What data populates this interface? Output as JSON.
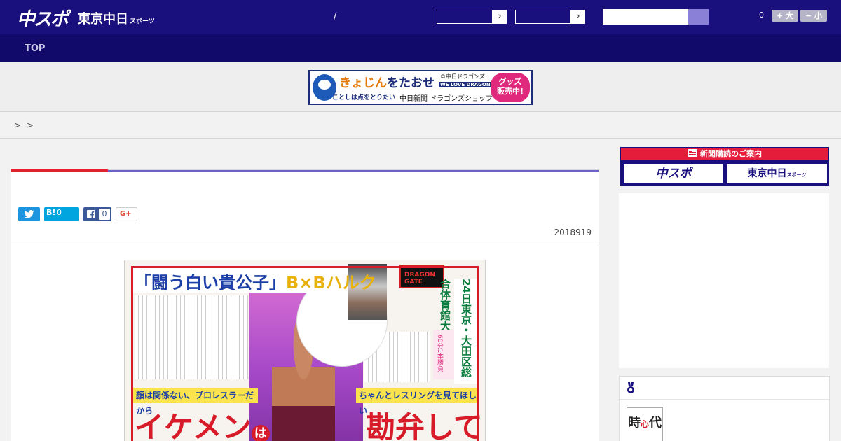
{
  "header": {
    "logo_primary": "中スポ",
    "logo_secondary": "東京中日",
    "logo_secondary_suffix": "スポーツ",
    "separator": "/",
    "dropdown_arrow": "›",
    "follow_count": "0",
    "font_larger": "+ 大",
    "font_smaller": "− 小"
  },
  "nav": {
    "top": "TOP"
  },
  "banner": {
    "headline_a": "きょじん",
    "headline_b": "をたおせ",
    "subline": "ことしは点をとりたい",
    "shop": "中日新聞 ドラゴンズショップ",
    "brand": "©中日ドラゴンズ",
    "brand_slogan": "WE LOVE DRAGONS",
    "badge_line1": "グッズ",
    "badge_line2": "販売中!"
  },
  "breadcrumb": {
    "sep1": ">",
    "sep2": ">"
  },
  "article": {
    "date": "2018919",
    "share": {
      "hatena_label": "B!",
      "hatena_count": "0",
      "facebook_count": "0",
      "google_label": "G+"
    },
    "newspaper": {
      "headline_a": "「闘う白い貴公子」",
      "headline_b": "B×Bハルク",
      "brand": "DRAGON GATE",
      "vertical_right": "24日東京・大田区総合体育館大会",
      "kawaii_note": "60分1本勝負",
      "band_left": "顔は関係ない、プロレスラーだから",
      "band_right": "ちゃんとレスリングを見てほしい",
      "big_left_a": "イケメン",
      "big_left_b": "は",
      "big_right": "勘弁して"
    }
  },
  "sidebar": {
    "subscribe_title": "新聞購読のご案内",
    "subscribe_chuspo": "中スポ",
    "subscribe_tokyo": "東京中日",
    "subscribe_tokyo_suffix": "スポーツ",
    "ranking_thumb_a": "時",
    "ranking_thumb_b": "代",
    "ranking_thumb_mark": "心"
  },
  "colors": {
    "header_bg": "#190f7d",
    "nav_bg": "#120a6a",
    "accent_red": "#e0222e",
    "accent_purple": "#6b60c9"
  }
}
